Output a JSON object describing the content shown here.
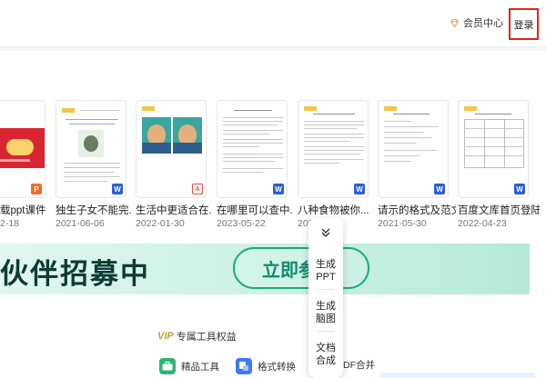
{
  "header": {
    "vip_center": "会员中心",
    "login": "登录"
  },
  "documents": [
    {
      "title": "载ppt课件",
      "date": "2-18",
      "format": "P"
    },
    {
      "title": "独生子女不能完...",
      "date": "2021-06-06",
      "format": "W"
    },
    {
      "title": "生活中更适合在...",
      "date": "2022-01-30",
      "format": "PDF"
    },
    {
      "title": "在哪里可以查中...",
      "date": "2023-05-22",
      "format": "W"
    },
    {
      "title": "八种食物被你...",
      "date": "2021-03-",
      "format": "W"
    },
    {
      "title": "请示的格式及范文",
      "date": "2021-05-30",
      "format": "W"
    },
    {
      "title": "百度文库首页登陆",
      "date": "2022-04-23",
      "format": "W"
    }
  ],
  "banner": {
    "headline": "伙伴招募中",
    "cta": "立即参"
  },
  "float_menu": {
    "items": [
      "生成\nPPT",
      "生成\n脑图",
      "文档\n合成"
    ]
  },
  "vip_tools": {
    "logo": "VIP",
    "title": "专属工具权益",
    "tools": [
      {
        "label": "精品工具",
        "icon": "toolbox-icon"
      },
      {
        "label": "格式转换",
        "icon": "convert-icon"
      },
      {
        "label": "DF合并",
        "icon": "pdf-merge-icon"
      }
    ]
  },
  "colors": {
    "login_border": "#e2231a",
    "banner_accent": "#1aa986",
    "vip_gold": "#c99a3a"
  }
}
